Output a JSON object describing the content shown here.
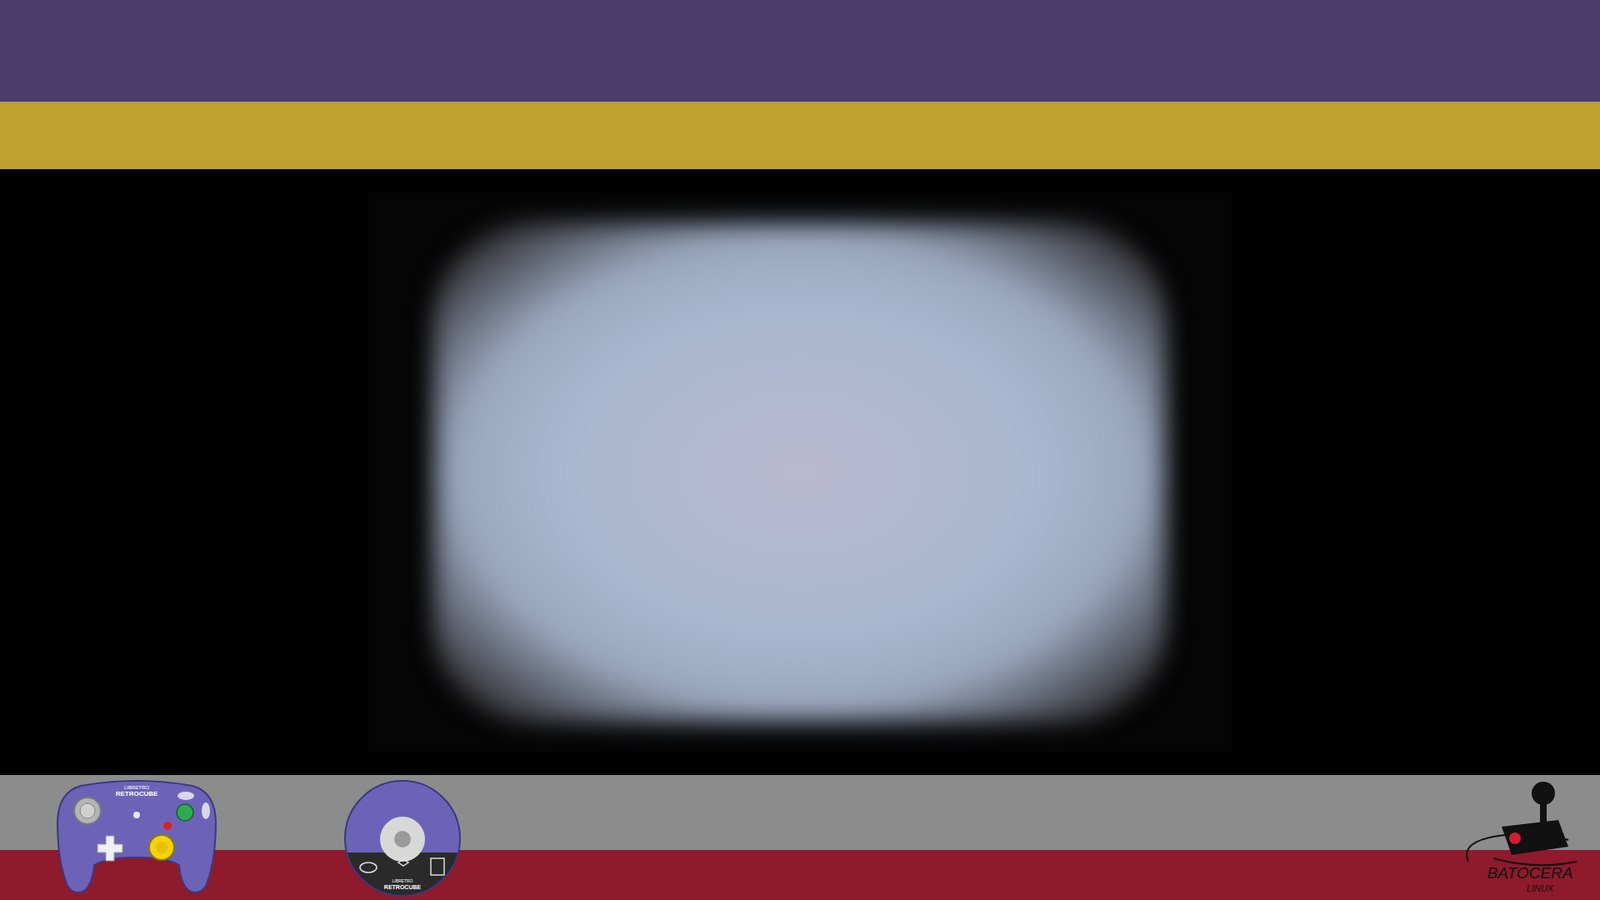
{
  "controller": {
    "brand": "LIBRETRO",
    "model": "RETROCUBE"
  },
  "disc": {
    "brand": "LIBRETRO",
    "model": "RETROCUBE"
  },
  "logo": {
    "name": "BATOCERA",
    "subtitle": "LINUX"
  }
}
